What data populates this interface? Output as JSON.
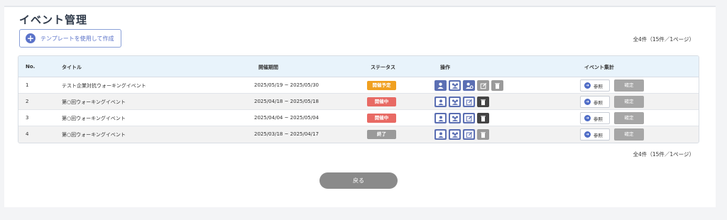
{
  "page": {
    "title": "イベント管理"
  },
  "toolbar": {
    "template_button_label": "テンプレートを使用して作成"
  },
  "summary": {
    "count_text": "全4件（15件／1ページ）"
  },
  "table": {
    "headers": {
      "no": "No.",
      "title": "タイトル",
      "period": "開催期間",
      "status": "ステータス",
      "actions": "操作",
      "aggregate": "イベント集計"
    },
    "rows": [
      {
        "no": "1",
        "title": "テスト企業対抗ウォーキングイベント",
        "period": "2025/05/19 ~ 2025/05/30",
        "status": "開催予定",
        "status_color": "#f0a020",
        "ref_label": "参照",
        "confirm_label": "確定"
      },
      {
        "no": "2",
        "title": "第○回ウォーキングイベント",
        "period": "2025/04/18 ~ 2025/05/18",
        "status": "開催中",
        "status_color": "#e86a64",
        "ref_label": "参照",
        "confirm_label": "確定"
      },
      {
        "no": "3",
        "title": "第○回ウォーキングイベント",
        "period": "2025/04/04 ~ 2025/05/04",
        "status": "開催中",
        "status_color": "#e86a64",
        "ref_label": "参照",
        "confirm_label": "確定"
      },
      {
        "no": "4",
        "title": "第○回ウォーキングイベント",
        "period": "2025/03/18 ~ 2025/04/17",
        "status": "終了",
        "status_color": "#9a9a9a",
        "ref_label": "参照",
        "confirm_label": "確定"
      }
    ]
  },
  "footer": {
    "back_label": "戻る"
  },
  "colors": {
    "accent": "#5b73c9",
    "header_bg": "#e8f3fb"
  }
}
